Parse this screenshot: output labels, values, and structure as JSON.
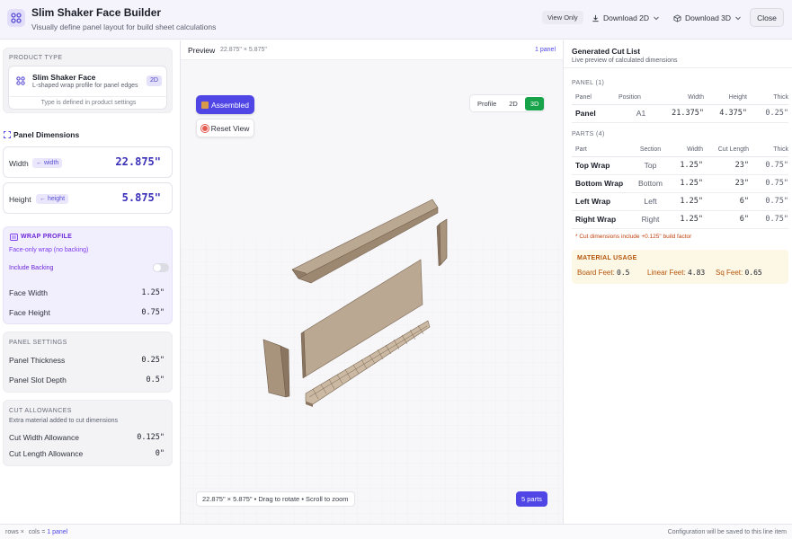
{
  "header": {
    "title": "Slim Shaker Face Builder",
    "subtitle": "Visually define panel layout for build sheet calculations",
    "view_only": "View Only",
    "download_2d": "Download 2D",
    "download_3d": "Download 3D",
    "close": "Close"
  },
  "left": {
    "product_type_label": "PRODUCT TYPE",
    "product_name": "Slim Shaker Face",
    "product_desc": "L-shaped wrap profile for panel edges",
    "product_badge": "2D",
    "product_note": "Type is defined in product settings",
    "panel_dims_title": "Panel Dimensions",
    "width_label": "Width",
    "width_chip": "← width",
    "width_value": "22.875\"",
    "height_label": "Height",
    "height_chip": "← height",
    "height_value": "5.875\"",
    "wrap_title": "WRAP PROFILE",
    "wrap_desc": "Face-only wrap (no backing)",
    "include_backing": "Include Backing",
    "face_width_label": "Face Width",
    "face_width_value": "1.25\"",
    "face_height_label": "Face Height",
    "face_height_value": "0.75\"",
    "panel_settings_title": "PANEL SETTINGS",
    "panel_thickness_label": "Panel Thickness",
    "panel_thickness_value": "0.25\"",
    "panel_slot_label": "Panel Slot Depth",
    "panel_slot_value": "0.5\"",
    "cut_allow_title": "CUT ALLOWANCES",
    "cut_allow_desc": "Extra material added to cut dimensions",
    "cut_width_label": "Cut Width Allowance",
    "cut_width_value": "0.125\"",
    "cut_length_label": "Cut Length Allowance",
    "cut_length_value": "0\""
  },
  "center": {
    "preview_label": "Preview",
    "preview_dims": "22.875\" × 5.875\"",
    "panel_count": "1 panel",
    "assembled": "Assembled",
    "reset_view": "Reset View",
    "seg_profile": "Profile",
    "seg_2d": "2D",
    "seg_3d": "3D",
    "footer_hint": "22.875\" × 5.875\"   •  Drag to rotate • Scroll to zoom",
    "parts_count": "5 parts"
  },
  "right": {
    "title": "Generated Cut List",
    "subtitle": "Live preview of calculated dimensions",
    "panel_section": "PANEL (1)",
    "panel_headers": [
      "Panel",
      "Position",
      "Width",
      "Height",
      "Thick"
    ],
    "panel_rows": [
      [
        "Panel",
        "A1",
        "21.375\"",
        "4.375\"",
        "0.25\""
      ]
    ],
    "parts_section": "PARTS (4)",
    "parts_headers": [
      "Part",
      "Section",
      "Width",
      "Cut Length",
      "Thick"
    ],
    "parts_rows": [
      [
        "Top Wrap",
        "Top",
        "1.25\"",
        "23\"",
        "0.75\""
      ],
      [
        "Bottom Wrap",
        "Bottom",
        "1.25\"",
        "23\"",
        "0.75\""
      ],
      [
        "Left Wrap",
        "Left",
        "1.25\"",
        "6\"",
        "0.75\""
      ],
      [
        "Right Wrap",
        "Right",
        "1.25\"",
        "6\"",
        "0.75\""
      ]
    ],
    "note": "* Cut dimensions include +0.125\" build factor",
    "material_title": "MATERIAL USAGE",
    "board_feet_label": "Board Feet:",
    "board_feet_value": "0.5",
    "linear_feet_label": "Linear Feet:",
    "linear_feet_value": "4.83",
    "sq_feet_label": "Sq Feet:",
    "sq_feet_value": "0.65"
  },
  "footer": {
    "grid_rows": "rows",
    "grid_sep": "×",
    "grid_cols": "cols",
    "grid_eq": "=",
    "grid_result": "1 panel",
    "save_note": "Configuration will be saved to this line item"
  },
  "colors": {
    "accent": "#4f46e5",
    "active_3d": "#16a34a",
    "wood": "#a38c73"
  }
}
